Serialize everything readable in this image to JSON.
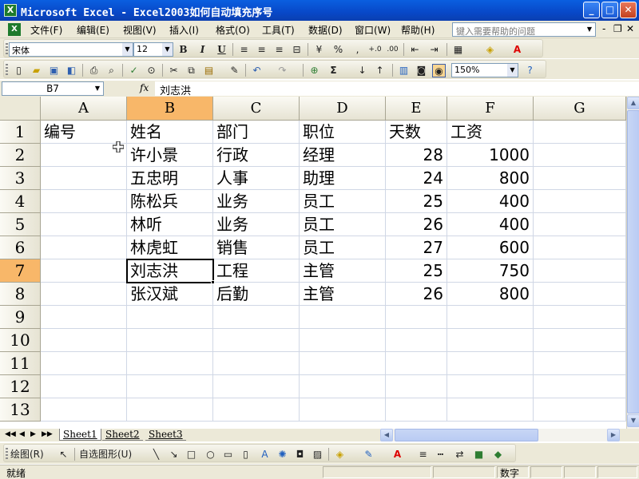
{
  "window": {
    "title": "Microsoft Excel - Excel2003如何自动填充序号",
    "minimize": "_",
    "maximize": "□",
    "close": "✕"
  },
  "menu": {
    "items": [
      "文件(F)",
      "编辑(E)",
      "视图(V)",
      "插入(I)",
      "格式(O)",
      "工具(T)",
      "数据(D)",
      "窗口(W)",
      "帮助(H)"
    ],
    "help_placeholder": "键入需要帮助的问题",
    "mdi_minimize": "-",
    "mdi_restore": "❐",
    "mdi_close": "✕"
  },
  "format_toolbar": {
    "font": "宋体",
    "size": "12",
    "bold": "B",
    "italic": "I",
    "underline": "U",
    "percent": "%",
    "comma": ",",
    "inc_decimal": "+.0",
    "dec_decimal": ".00",
    "font_color": "A"
  },
  "standard_toolbar": {
    "zoom": "150%",
    "autosum": "Σ"
  },
  "formula_bar": {
    "name_box": "B7",
    "fx": "fx",
    "content": "刘志洪"
  },
  "columns": [
    "A",
    "B",
    "C",
    "D",
    "E",
    "F",
    "G"
  ],
  "rows": [
    "1",
    "2",
    "3",
    "4",
    "5",
    "6",
    "7",
    "8",
    "9",
    "10",
    "11",
    "12",
    "13"
  ],
  "cells": [
    [
      "编号",
      "姓名",
      "部门",
      "职位",
      "天数",
      "工资",
      ""
    ],
    [
      "",
      "许小景",
      "行政",
      "经理",
      "28",
      "1000",
      ""
    ],
    [
      "",
      "五忠明",
      "人事",
      "助理",
      "24",
      "800",
      ""
    ],
    [
      "",
      "陈松兵",
      "业务",
      "员工",
      "25",
      "400",
      ""
    ],
    [
      "",
      "林听",
      "业务",
      "员工",
      "26",
      "400",
      ""
    ],
    [
      "",
      "林虎虹",
      "销售",
      "员工",
      "27",
      "600",
      ""
    ],
    [
      "",
      "刘志洪",
      "工程",
      "主管",
      "25",
      "750",
      ""
    ],
    [
      "",
      "张汉斌",
      "后勤",
      "主管",
      "26",
      "800",
      ""
    ],
    [
      "",
      "",
      "",
      "",
      "",
      "",
      ""
    ],
    [
      "",
      "",
      "",
      "",
      "",
      "",
      ""
    ],
    [
      "",
      "",
      "",
      "",
      "",
      "",
      ""
    ],
    [
      "",
      "",
      "",
      "",
      "",
      "",
      ""
    ],
    [
      "",
      "",
      "",
      "",
      "",
      "",
      ""
    ]
  ],
  "sheets": [
    "Sheet1",
    "Sheet2",
    "Sheet3"
  ],
  "drawing_toolbar": {
    "draw": "绘图(R)",
    "autoshapes": "自选图形(U)"
  },
  "status": {
    "ready": "就绪",
    "numlock": "数字"
  },
  "colors": {
    "title_bar": "#0848c8",
    "selected_header": "#f8b769",
    "chrome": "#ece9d8",
    "gridline": "#d0d7e5"
  }
}
